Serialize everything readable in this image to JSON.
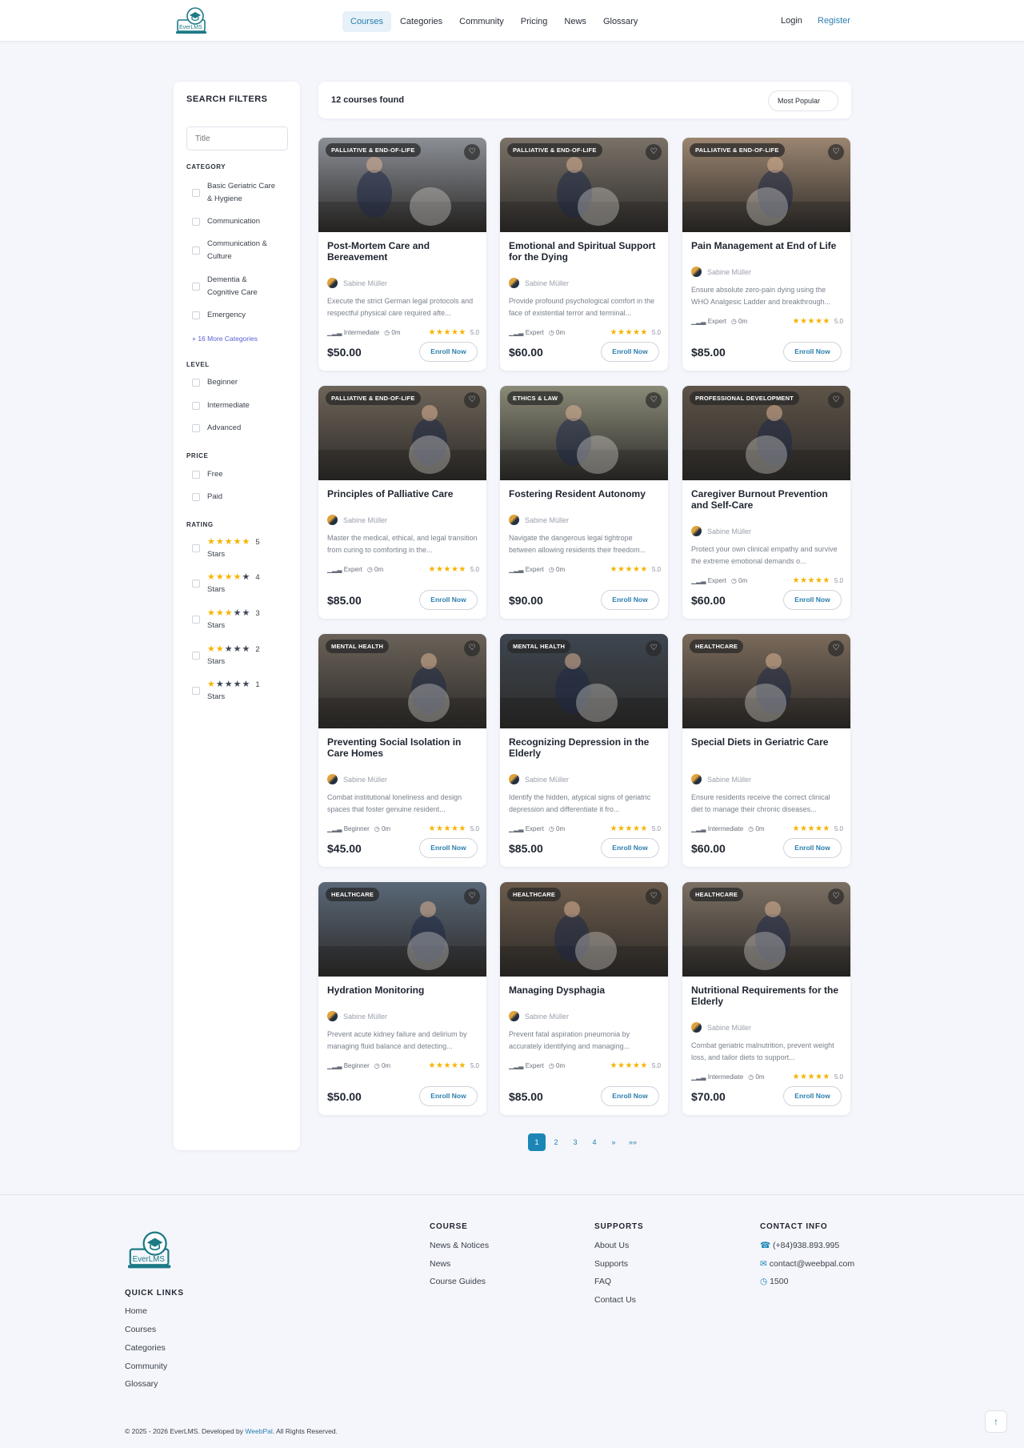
{
  "header": {
    "logo_text": "EverLMS",
    "nav": [
      "Courses",
      "Categories",
      "Community",
      "Pricing",
      "News",
      "Glossary"
    ],
    "login": "Login",
    "register": "Register"
  },
  "filters": {
    "title": "SEARCH FILTERS",
    "title_placeholder": "Title",
    "category_heading": "CATEGORY",
    "categories": [
      [
        "Basic Geriatric Care",
        "& Hygiene"
      ],
      [
        "Communication"
      ],
      [
        "Communication &",
        "Culture"
      ],
      [
        "Dementia &",
        "Cognitive Care"
      ],
      [
        "Emergency"
      ]
    ],
    "more_categories": "+ 16 More Categories",
    "level_heading": "LEVEL",
    "levels": [
      "Beginner",
      "Intermediate",
      "Advanced"
    ],
    "price_heading": "PRICE",
    "prices": [
      "Free",
      "Paid"
    ],
    "rating_heading": "RATING",
    "ratings": [
      {
        "value": 5,
        "num": "5",
        "label": "Stars"
      },
      {
        "value": 4,
        "num": "4",
        "label": "Stars"
      },
      {
        "value": 3,
        "num": "3",
        "label": "Stars"
      },
      {
        "value": 2,
        "num": "2",
        "label": "Stars"
      },
      {
        "value": 1,
        "num": "1",
        "label": "Stars"
      }
    ]
  },
  "results": {
    "count_text": "12 courses found",
    "sort_label": "Most Popular"
  },
  "card_labels": {
    "enroll": "Enroll Now",
    "heart_icon": "heart-icon"
  },
  "courses": [
    {
      "badge": "PALLIATIVE & END-OF-LIFE",
      "title": "Post-Mortem Care and Bereavement",
      "author": "Sabine Müller",
      "desc": "Execute the strict German legal protocols and respectful physical care required afte...",
      "level": "Intermediate",
      "duration": "0m",
      "rating": "5.0",
      "price": "$50.00",
      "tone": "#8b8f96"
    },
    {
      "badge": "PALLIATIVE & END-OF-LIFE",
      "title": "Emotional and Spiritual Support for the Dying",
      "author": "Sabine Müller",
      "desc": "Provide profound psychological comfort in the face of existential terror and terminal...",
      "level": "Expert",
      "duration": "0m",
      "rating": "5.0",
      "price": "$60.00",
      "tone": "#7a7268"
    },
    {
      "badge": "PALLIATIVE & END-OF-LIFE",
      "title": "Pain Management at End of Life",
      "author": "Sabine Müller",
      "desc": "Ensure absolute zero-pain dying using the WHO Analgesic Ladder and breakthrough...",
      "level": "Expert",
      "duration": "0m",
      "rating": "5.0",
      "price": "$85.00",
      "tone": "#9b8570"
    },
    {
      "badge": "PALLIATIVE & END-OF-LIFE",
      "title": "Principles of Palliative Care",
      "author": "Sabine Müller",
      "desc": "Master the medical, ethical, and legal transition from curing to comforting in the...",
      "level": "Expert",
      "duration": "0m",
      "rating": "5.0",
      "price": "$85.00",
      "tone": "#6e6458"
    },
    {
      "badge": "ETHICS & LAW",
      "title": "Fostering Resident Autonomy",
      "author": "Sabine Müller",
      "desc": "Navigate the dangerous legal tightrope between allowing residents their freedom...",
      "level": "Expert",
      "duration": "0m",
      "rating": "5.0",
      "price": "$90.00",
      "tone": "#8a8a78"
    },
    {
      "badge": "PROFESSIONAL DEVELOPMENT",
      "title": "Caregiver Burnout Prevention and Self-Care",
      "author": "Sabine Müller",
      "desc": "Protect your own clinical empathy and survive the extreme emotional demands o...",
      "level": "Expert",
      "duration": "0m",
      "rating": "5.0",
      "price": "$60.00",
      "tone": "#5e5448"
    },
    {
      "badge": "MENTAL HEALTH",
      "title": "Preventing Social Isolation in Care Homes",
      "author": "Sabine Müller",
      "desc": "Combat institutional loneliness and design spaces that foster genuine resident...",
      "level": "Beginner",
      "duration": "0m",
      "rating": "5.0",
      "price": "$45.00",
      "tone": "#6a6258"
    },
    {
      "badge": "MENTAL HEALTH",
      "title": "Recognizing Depression in the Elderly",
      "author": "Sabine Müller",
      "desc": "Identify the hidden, atypical signs of geriatric depression and differentiate it fro...",
      "level": "Expert",
      "duration": "0m",
      "rating": "5.0",
      "price": "$85.00",
      "tone": "#3e4650"
    },
    {
      "badge": "HEALTHCARE",
      "title": "Special Diets in Geriatric Care",
      "author": "Sabine Müller",
      "desc": "Ensure residents receive the correct clinical diet to manage their chronic diseases...",
      "level": "Intermediate",
      "duration": "0m",
      "rating": "5.0",
      "price": "$60.00",
      "tone": "#7a6a5a"
    },
    {
      "badge": "HEALTHCARE",
      "title": "Hydration Monitoring",
      "author": "Sabine Müller",
      "desc": "Prevent acute kidney failure and delirium by managing fluid balance and detecting...",
      "level": "Beginner",
      "duration": "0m",
      "rating": "5.0",
      "price": "$50.00",
      "tone": "#5a6878"
    },
    {
      "badge": "HEALTHCARE",
      "title": "Managing Dysphagia",
      "author": "Sabine Müller",
      "desc": "Prevent fatal aspiration pneumonia by accurately identifying and managing...",
      "level": "Expert",
      "duration": "0m",
      "rating": "5.0",
      "price": "$85.00",
      "tone": "#6c5c4c"
    },
    {
      "badge": "HEALTHCARE",
      "title": "Nutritional Requirements for the Elderly",
      "author": "Sabine Müller",
      "desc": "Combat geriatric malnutrition, prevent weight loss, and tailor diets to support...",
      "level": "Intermediate",
      "duration": "0m",
      "rating": "5.0",
      "price": "$70.00",
      "tone": "#7c7064"
    }
  ],
  "pagination": [
    "1",
    "2",
    "3",
    "4",
    "»",
    "»»"
  ],
  "footer": {
    "logo_text": "EverLMS",
    "quick_links_heading": "QUICK LINKS",
    "quick_links": [
      "Home",
      "Courses",
      "Categories",
      "Community",
      "Glossary"
    ],
    "course_heading": "COURSE",
    "course_links": [
      "News & Notices",
      "News",
      "Course Guides"
    ],
    "supports_heading": "SUPPORTS",
    "supports_links": [
      "About Us",
      "Supports",
      "FAQ",
      "Contact Us"
    ],
    "contact_heading": "CONTACT INFO",
    "phone": "(+84)938.893.995",
    "email": "contact@weebpal.com",
    "hours": "1500",
    "copyright_prefix": "© 2025 - 2026 EverLMS. Developed by ",
    "copyright_link": "WeebPal",
    "copyright_suffix": ". All Rights Reserved."
  },
  "colors": {
    "accent": "#2b7fae",
    "star": "#f5b400",
    "pager_active": "#1b86b6"
  }
}
